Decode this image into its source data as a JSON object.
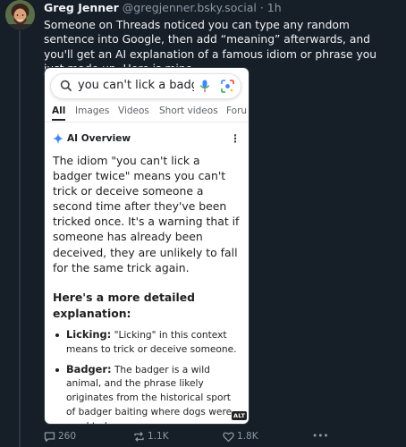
{
  "post": {
    "author_name": "Greg Jenner",
    "author_handle": "@gregjenner.bsky.social",
    "separator": "·",
    "time": "1h",
    "text": "Someone on Threads noticed you can type any random sentence into Google, then add “meaning” afterwards, and you'll get an AI explanation of a famous idiom or phrase you just made up. Here is mine"
  },
  "screenshot": {
    "search_query": "you can't lick a badger tw",
    "tabs": [
      "All",
      "Images",
      "Videos",
      "Short videos",
      "Foru"
    ],
    "active_tab": "All",
    "ai_overview_label": "AI Overview",
    "ai_overview_text": "The idiom \"you can't lick a badger twice\" means you can't trick or deceive someone a second time after they've been tricked once. It's a warning that if someone has already been deceived, they are unlikely to fall for the same trick again.",
    "detail_heading": "Here's a more detailed explanation:",
    "bullets": [
      {
        "term": "Licking:",
        "text": " \"Licking\" in this context means to trick or deceive someone."
      },
      {
        "term": "Badger:",
        "text": " The badger is a wild animal, and the phrase likely originates from the historical sport of badger baiting where dogs were used to harass"
      }
    ],
    "alt_badge": "ALT"
  },
  "actions": {
    "replies": "260",
    "reposts": "1.1K",
    "likes": "1.8K",
    "more": "•••"
  },
  "colors": {
    "background": "#161e27",
    "muted_text": "#8b98a5",
    "google_blue": "#4285f4"
  }
}
